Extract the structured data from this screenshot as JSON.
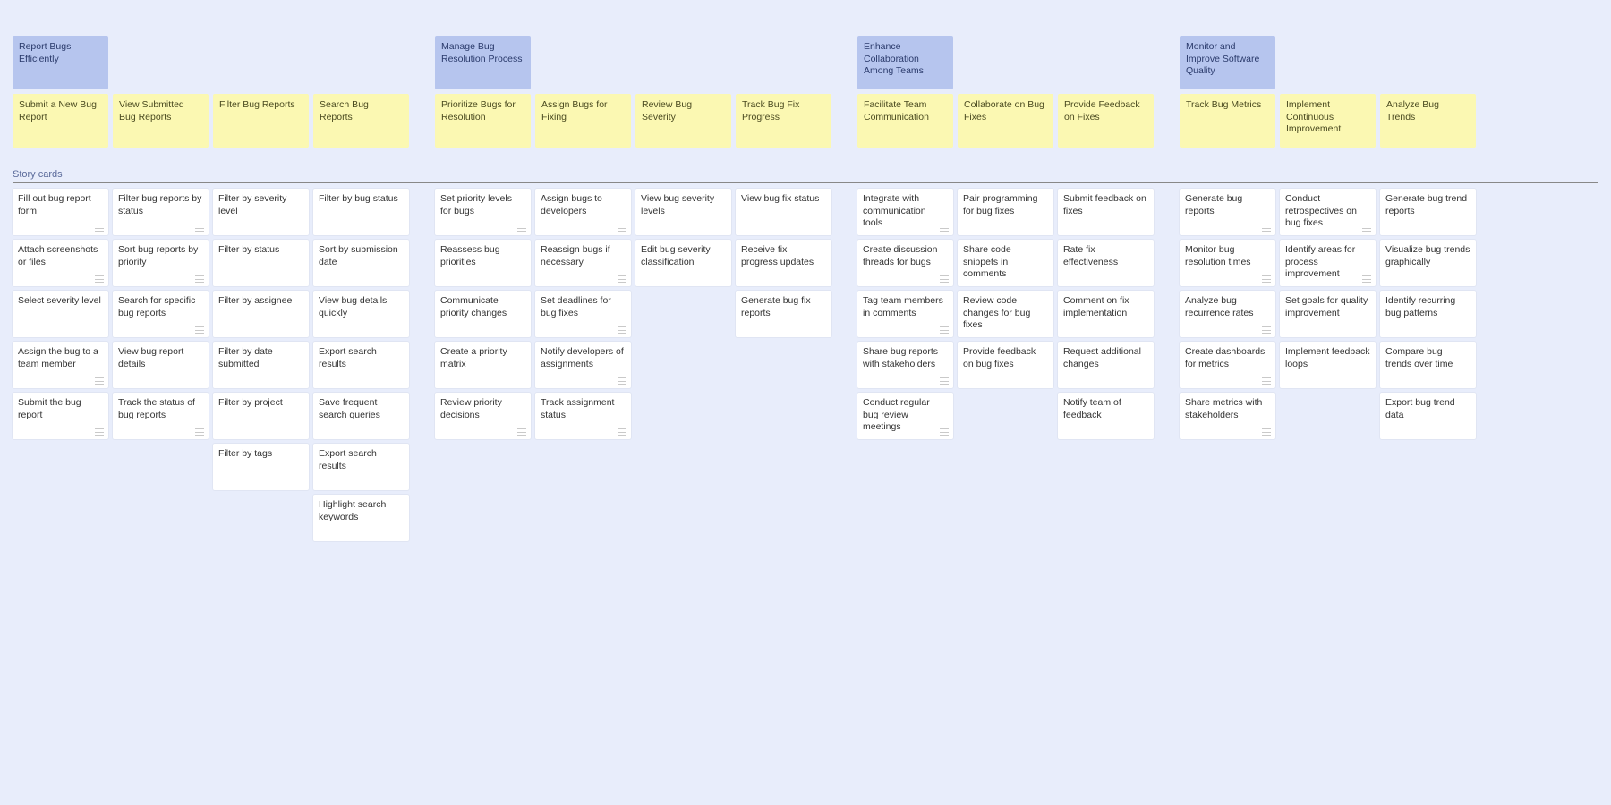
{
  "storyHeader": "Story cards",
  "groups": [
    {
      "epic": "Report Bugs Efficiently",
      "columns": [
        {
          "feature": "Submit a New Bug Report",
          "stories": [
            {
              "text": "Fill out bug report form",
              "icon": true
            },
            {
              "text": "Attach screenshots or files",
              "icon": true
            },
            {
              "text": "Select severity level",
              "icon": false
            },
            {
              "text": "Assign the bug to a team member",
              "icon": true
            },
            {
              "text": "Submit the bug report",
              "icon": true
            }
          ]
        },
        {
          "feature": "View Submitted Bug Reports",
          "stories": [
            {
              "text": "Filter bug reports by status",
              "icon": true
            },
            {
              "text": "Sort bug reports by priority",
              "icon": true
            },
            {
              "text": "Search for specific bug reports",
              "icon": true
            },
            {
              "text": "View bug report details",
              "icon": false
            },
            {
              "text": "Track the status of bug reports",
              "icon": true
            }
          ]
        },
        {
          "feature": "Filter Bug Reports",
          "stories": [
            {
              "text": "Filter by severity level",
              "icon": false
            },
            {
              "text": "Filter by status",
              "icon": false
            },
            {
              "text": "Filter by assignee",
              "icon": false
            },
            {
              "text": "Filter by date submitted",
              "icon": false
            },
            {
              "text": "Filter by project",
              "icon": false
            },
            {
              "text": "Filter by tags",
              "icon": false
            }
          ]
        },
        {
          "feature": "Search Bug Reports",
          "stories": [
            {
              "text": "Filter by bug status",
              "icon": false
            },
            {
              "text": "Sort by submission date",
              "icon": false
            },
            {
              "text": "View bug details quickly",
              "icon": false
            },
            {
              "text": "Export search results",
              "icon": false
            },
            {
              "text": "Save frequent search queries",
              "icon": false
            },
            {
              "text": "Export search results",
              "icon": false
            },
            {
              "text": "Highlight search keywords",
              "icon": false
            }
          ]
        }
      ]
    },
    {
      "epic": "Manage Bug Resolution Process",
      "columns": [
        {
          "feature": "Prioritize Bugs for Resolution",
          "stories": [
            {
              "text": "Set priority levels for bugs",
              "icon": true
            },
            {
              "text": "Reassess bug priorities",
              "icon": false
            },
            {
              "text": "Communicate priority changes",
              "icon": false
            },
            {
              "text": "Create a priority matrix",
              "icon": false
            },
            {
              "text": "Review priority decisions",
              "icon": true
            }
          ]
        },
        {
          "feature": "Assign Bugs for Fixing",
          "stories": [
            {
              "text": "Assign bugs to developers",
              "icon": true
            },
            {
              "text": "Reassign bugs if necessary",
              "icon": true
            },
            {
              "text": "Set deadlines for bug fixes",
              "icon": true
            },
            {
              "text": "Notify developers of assignments",
              "icon": true
            },
            {
              "text": "Track assignment status",
              "icon": true
            }
          ]
        },
        {
          "feature": "Review Bug Severity",
          "stories": [
            {
              "text": "View bug severity levels",
              "icon": false
            },
            {
              "text": "Edit bug severity classification",
              "icon": false
            }
          ]
        },
        {
          "feature": "Track Bug Fix Progress",
          "stories": [
            {
              "text": "View bug fix status",
              "icon": false
            },
            {
              "text": "Receive fix progress updates",
              "icon": false
            },
            {
              "text": "Generate bug fix reports",
              "icon": false
            }
          ]
        }
      ]
    },
    {
      "epic": "Enhance Collaboration Among Teams",
      "columns": [
        {
          "feature": "Facilitate Team Communication",
          "stories": [
            {
              "text": "Integrate with communication tools",
              "icon": true
            },
            {
              "text": "Create discussion threads for bugs",
              "icon": true
            },
            {
              "text": "Tag team members in comments",
              "icon": true
            },
            {
              "text": "Share bug reports with stakeholders",
              "icon": true
            },
            {
              "text": "Conduct regular bug review meetings",
              "icon": true
            }
          ]
        },
        {
          "feature": "Collaborate on Bug Fixes",
          "stories": [
            {
              "text": "Pair programming for bug fixes",
              "icon": false
            },
            {
              "text": "Share code snippets in comments",
              "icon": false
            },
            {
              "text": "Review code changes for bug fixes",
              "icon": false
            },
            {
              "text": "Provide feedback on bug fixes",
              "icon": false
            }
          ]
        },
        {
          "feature": "Provide Feedback on Fixes",
          "stories": [
            {
              "text": "Submit feedback on fixes",
              "icon": false
            },
            {
              "text": "Rate fix effectiveness",
              "icon": false
            },
            {
              "text": "Comment on fix implementation",
              "icon": false
            },
            {
              "text": "Request additional changes",
              "icon": false
            },
            {
              "text": "Notify team of feedback",
              "icon": false
            }
          ]
        }
      ]
    },
    {
      "epic": "Monitor and Improve Software Quality",
      "columns": [
        {
          "feature": "Track Bug Metrics",
          "stories": [
            {
              "text": "Generate bug reports",
              "icon": true
            },
            {
              "text": "Monitor bug resolution times",
              "icon": true
            },
            {
              "text": "Analyze bug recurrence rates",
              "icon": true
            },
            {
              "text": "Create dashboards for metrics",
              "icon": true
            },
            {
              "text": "Share metrics with stakeholders",
              "icon": true
            }
          ]
        },
        {
          "feature": "Implement Continuous Improvement",
          "stories": [
            {
              "text": "Conduct retrospectives on bug fixes",
              "icon": true
            },
            {
              "text": "Identify areas for process improvement",
              "icon": true
            },
            {
              "text": "Set goals for quality improvement",
              "icon": false
            },
            {
              "text": "Implement feedback loops",
              "icon": false
            }
          ]
        },
        {
          "feature": "Analyze Bug Trends",
          "stories": [
            {
              "text": "Generate bug trend reports",
              "icon": false
            },
            {
              "text": "Visualize bug trends graphically",
              "icon": false
            },
            {
              "text": "Identify recurring bug patterns",
              "icon": false
            },
            {
              "text": "Compare bug trends over time",
              "icon": false
            },
            {
              "text": "Export bug trend data",
              "icon": false
            }
          ]
        }
      ]
    }
  ]
}
